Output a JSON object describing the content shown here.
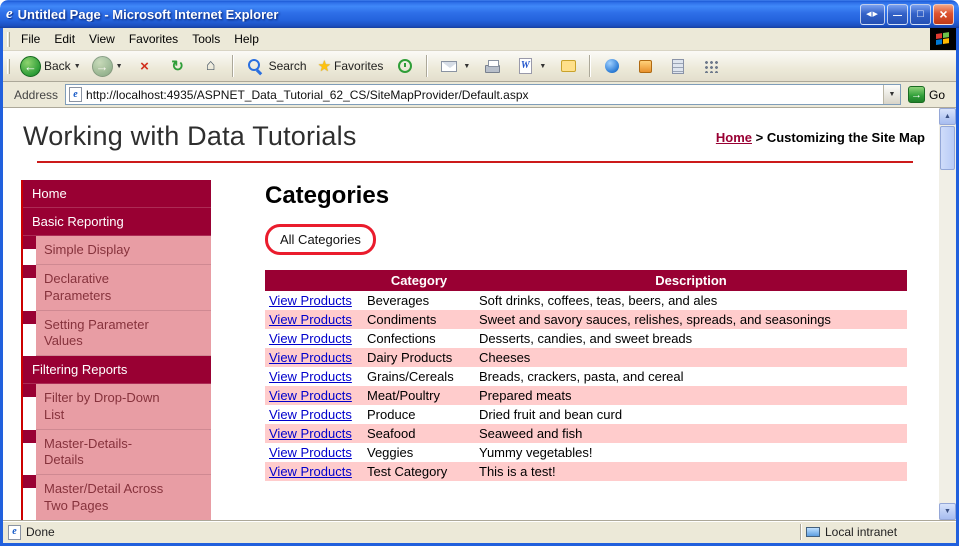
{
  "window": {
    "title": "Untitled Page - Microsoft Internet Explorer"
  },
  "glyphs": {
    "arrows": "◀▶",
    "minimize": "—",
    "maximize": "□",
    "close": "×",
    "back_arrow": "←",
    "forward_arrow": "→",
    "dropdown": "▼",
    "stop": "×",
    "refresh": "↻",
    "home": "⌂",
    "star": "★",
    "go_arrow": "→",
    "edit_w": "W",
    "page_e": "e",
    "scroll_up": "▲",
    "scroll_down": "▼"
  },
  "menu": {
    "items": [
      "File",
      "Edit",
      "View",
      "Favorites",
      "Tools",
      "Help"
    ]
  },
  "toolbar": {
    "back_label": "Back",
    "search_label": "Search",
    "favorites_label": "Favorites"
  },
  "address": {
    "label": "Address",
    "url": "http://localhost:4935/ASPNET_Data_Tutorial_62_CS/SiteMapProvider/Default.aspx",
    "go_label": "Go"
  },
  "page": {
    "title": "Working with Data Tutorials",
    "breadcrumb": {
      "home": "Home",
      "separator": ">",
      "current": "Customizing the Site Map"
    },
    "sidebar": [
      {
        "label": "Home",
        "level": 0
      },
      {
        "label": "Basic Reporting",
        "level": 0
      },
      {
        "label": "Simple Display",
        "level": 1
      },
      {
        "label": "Declarative Parameters",
        "level": 1
      },
      {
        "label": "Setting Parameter Values",
        "level": 1
      },
      {
        "label": "Filtering Reports",
        "level": 0
      },
      {
        "label": "Filter by Drop-Down List",
        "level": 1
      },
      {
        "label": "Master-Details-Details",
        "level": 1
      },
      {
        "label": "Master/Detail Across Two Pages",
        "level": 1
      }
    ],
    "main": {
      "heading": "Categories",
      "all_categories": "All Categories",
      "table": {
        "headers": [
          "",
          "Category",
          "Description"
        ],
        "link_label": "View Products",
        "rows": [
          {
            "category": "Beverages",
            "description": "Soft drinks, coffees, teas, beers, and ales"
          },
          {
            "category": "Condiments",
            "description": "Sweet and savory sauces, relishes, spreads, and seasonings"
          },
          {
            "category": "Confections",
            "description": "Desserts, candies, and sweet breads"
          },
          {
            "category": "Dairy Products",
            "description": "Cheeses"
          },
          {
            "category": "Grains/Cereals",
            "description": "Breads, crackers, pasta, and cereal"
          },
          {
            "category": "Meat/Poultry",
            "description": "Prepared meats"
          },
          {
            "category": "Produce",
            "description": "Dried fruit and bean curd"
          },
          {
            "category": "Seafood",
            "description": "Seaweed and fish"
          },
          {
            "category": "Veggies",
            "description": "Yummy vegetables!"
          },
          {
            "category": "Test Category",
            "description": "This is a test!"
          }
        ]
      }
    }
  },
  "status": {
    "left": "Done",
    "right": "Local intranet"
  },
  "colors": {
    "accent_maroon": "#990033",
    "sidebar_pink": "#e89da4",
    "row_pink": "#ffcccc",
    "rule_red": "#cc0000",
    "link_blue": "#0000cc",
    "annotation_red": "#ea1c2d",
    "titlebar_blue": "#2e6fe8"
  }
}
